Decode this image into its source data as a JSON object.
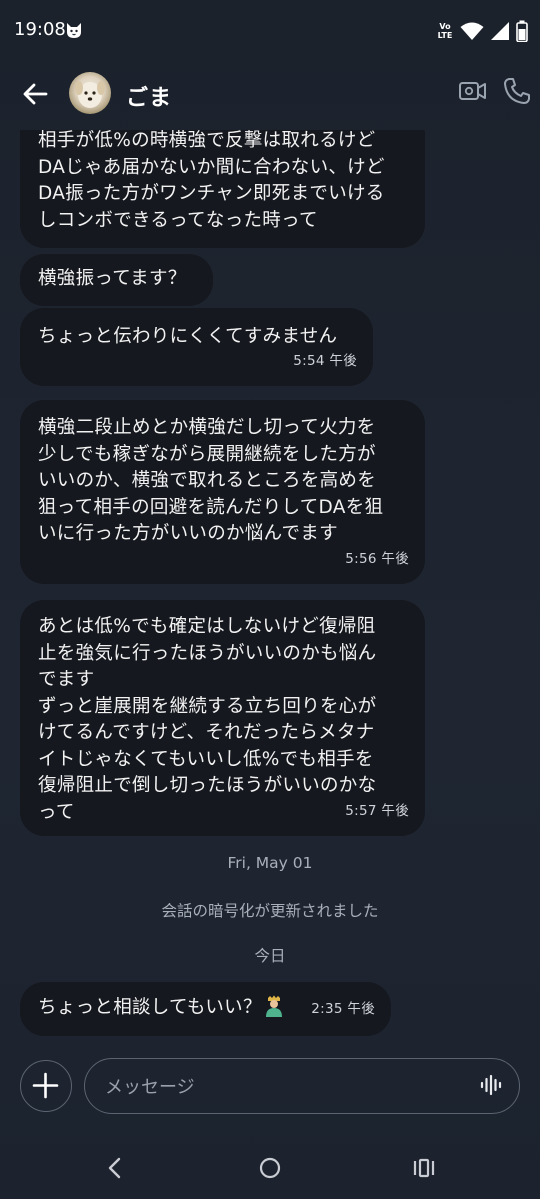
{
  "status_bar": {
    "time": "19:08",
    "volte": "Vo\nLTE"
  },
  "header": {
    "contact_name": "ごま"
  },
  "messages": [
    {
      "text": "相手が低%の時横強で反撃は取れるけど\nDAじゃあ届かないか間に合わない、けど\nDA振った方がワンチャン即死までいける\nしコンボできるってなった時って",
      "time": ""
    },
    {
      "text": "横強振ってます？",
      "time": ""
    },
    {
      "text": "ちょっと伝わりにくくてすみません",
      "time": "5:54 午後"
    },
    {
      "text": "横強二段止めとか横強だし切って火力を\n少しでも稼ぎながら展開継続をした方が\nいいのか、横強で取れるところを高めを\n狙って相手の回避を読んだりしてDAを狙\nいに行った方がいいのか悩んでます",
      "time": "5:56 午後"
    },
    {
      "text": "あとは低%でも確定はしないけど復帰阻\n止を強気に行ったほうがいいのかも悩ん\nでます\nずっと崖展開を継続する立ち回りを心が\nけてるんですけど、それだったらメタナ\nイトじゃなくてもいいし低%でも相手を\n復帰阻止で倒し切ったほうがいいのかな\nって",
      "time": "5:57 午後"
    },
    {
      "text": "ちょっと相談してもいい？",
      "time": "2:35 午後"
    }
  ],
  "separators": {
    "date": "Fri, May 01",
    "encryption_notice": "会話の暗号化が更新されました",
    "today": "今日"
  },
  "composer": {
    "placeholder": "メッセージ"
  },
  "icons": {
    "back": "arrow-left-icon",
    "video": "video-camera-icon",
    "call": "phone-icon",
    "plus": "plus-icon",
    "voice": "voice-waveform-icon",
    "nav_back": "chevron-left-icon",
    "nav_home": "circle-home-icon",
    "nav_recents": "recents-icon"
  },
  "colors": {
    "background": "#1e2430",
    "bubble": "#15181e",
    "separator_text": "#a9b0ba"
  }
}
